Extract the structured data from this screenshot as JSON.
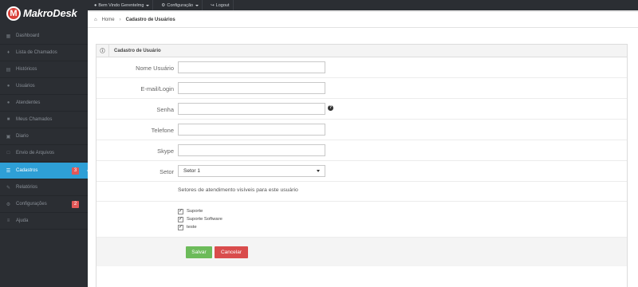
{
  "app": {
    "logo_letter": "M",
    "name": "MakroDesk"
  },
  "topnav": [
    {
      "label": "Bem Vindo Gerentelmg",
      "icon": "user-icon",
      "dropdown": true
    },
    {
      "label": "Configuração",
      "icon": "gear-icon",
      "dropdown": true
    },
    {
      "label": "Logout",
      "icon": "logout-icon",
      "dropdown": false
    }
  ],
  "breadcrumb": {
    "home": "Home",
    "current": "Cadastro de Usuários"
  },
  "sidebar": {
    "items": [
      {
        "label": "Dashboard",
        "icon": "dashboard-icon",
        "active": false,
        "badge": ""
      },
      {
        "label": "Lista de Chamados",
        "icon": "tag-icon",
        "active": false,
        "badge": ""
      },
      {
        "label": "Históricos",
        "icon": "history-icon",
        "active": false,
        "badge": ""
      },
      {
        "label": "Usuários",
        "icon": "users-icon",
        "active": false,
        "badge": ""
      },
      {
        "label": "Atendentes",
        "icon": "users-icon",
        "active": false,
        "badge": ""
      },
      {
        "label": "Meus Chamados",
        "icon": "folder-icon",
        "active": false,
        "badge": ""
      },
      {
        "label": "Diario",
        "icon": "inbox-icon",
        "active": false,
        "badge": ""
      },
      {
        "label": "Envio de Arquivos",
        "icon": "file-icon",
        "active": false,
        "badge": ""
      },
      {
        "label": "Cadastros",
        "icon": "list-icon",
        "active": true,
        "badge": "3"
      },
      {
        "label": "Relatórios",
        "icon": "pencil-icon",
        "active": false,
        "badge": ""
      },
      {
        "label": "Configurações",
        "icon": "gear-icon",
        "active": false,
        "badge": "2"
      },
      {
        "label": "Ajuda",
        "icon": "menu-icon",
        "active": false,
        "badge": ""
      }
    ]
  },
  "form": {
    "title": "Cadastro de Usuário",
    "fields": {
      "nome_label": "Nome Usuário",
      "email_label": "E-mail/Login",
      "senha_label": "Senha",
      "telefone_label": "Telefone",
      "skype_label": "Skype",
      "setor_label": "Setor",
      "nome_value": "",
      "email_value": "",
      "senha_value": "",
      "telefone_value": "",
      "skype_value": "",
      "setor_selected": "Setor 1"
    },
    "hint": "Setores de atendimento visíveis para este usuário",
    "sectors": [
      {
        "label": "Suporte",
        "checked": true
      },
      {
        "label": "Suporte Software",
        "checked": true
      },
      {
        "label": "teste",
        "checked": true
      }
    ],
    "save_label": "Salvar",
    "cancel_label": "Cancelar"
  },
  "colors": {
    "sidebar_bg": "#2b2e33",
    "active": "#2e9fd6",
    "badge": "#e25858",
    "save": "#6cbb5a",
    "cancel": "#d94c4c",
    "logo": "#d9413a"
  }
}
